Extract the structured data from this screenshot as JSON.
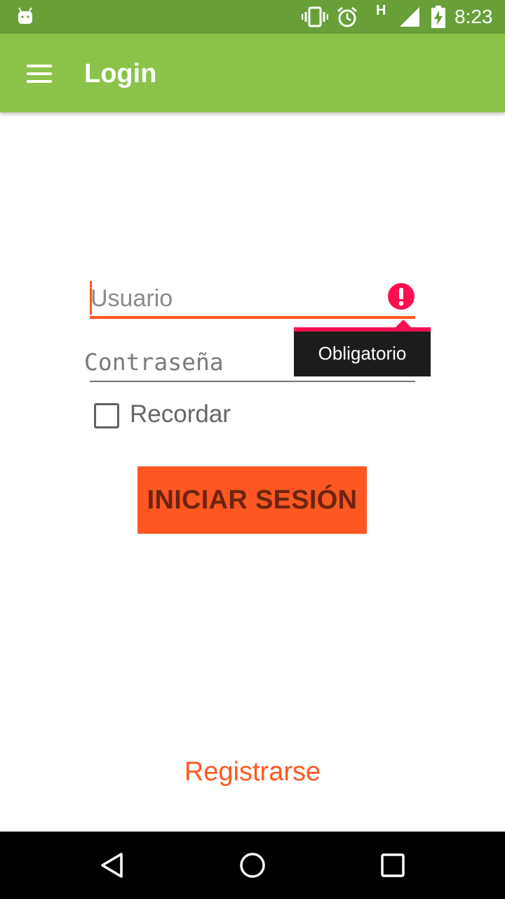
{
  "status_bar": {
    "network_type": "H",
    "time": "8:23",
    "icons": [
      "android-icon",
      "vibrate-icon",
      "alarm-icon",
      "signal-icon",
      "battery-charging-icon"
    ]
  },
  "app_bar": {
    "title": "Login",
    "menu_icon": "hamburger-menu-icon"
  },
  "form": {
    "username": {
      "placeholder": "Usuario",
      "value": ""
    },
    "password": {
      "placeholder": "Contraseña",
      "value": ""
    },
    "error_tooltip": "Obligatorio",
    "remember_label": "Recordar",
    "remember_checked": false,
    "login_button": "INICIAR SESIÓN"
  },
  "register_link": "Registrarse",
  "colors": {
    "status_bar": "#689f38",
    "app_bar": "#8bc34a",
    "accent": "#ff5722",
    "error": "#ff0f50"
  },
  "nav_bar": {
    "icons": [
      "back-icon",
      "home-icon",
      "recents-icon"
    ]
  }
}
